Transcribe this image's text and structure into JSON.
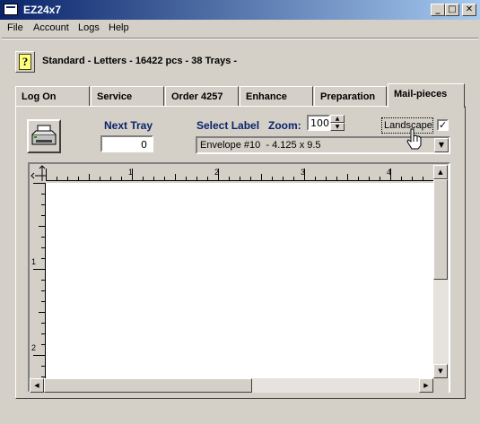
{
  "window": {
    "title": "EZ24x7"
  },
  "window_buttons": {
    "minimize": "_",
    "maximize": "□",
    "close": "✕"
  },
  "menu": [
    "File",
    "Account",
    "Logs",
    "Help"
  ],
  "help_button": {
    "label": "?"
  },
  "status_text": "Standard - Letters - 16422 pcs - 38 Trays -",
  "tabs": [
    "Log On",
    "Service",
    "Order 4257",
    "Enhance",
    "Preparation",
    "Mail-pieces"
  ],
  "active_tab": "Mail-pieces",
  "mailpieces": {
    "next_tray_label": "Next Tray",
    "next_tray_value": "0",
    "select_label": "Select Label",
    "zoom_label": "Zoom:",
    "zoom_value": "100",
    "landscape_label": "Landscape",
    "landscape_checked": "✓",
    "label_selected": "Envelope #10  - 4.125 x 9.5",
    "ruler_h_labels": [
      "1",
      "2",
      "3",
      "4"
    ],
    "ruler_v_labels": [
      "1",
      "2"
    ]
  },
  "icons": {
    "printer": "printer-icon",
    "hand_cursor": "hand-cursor-icon"
  }
}
